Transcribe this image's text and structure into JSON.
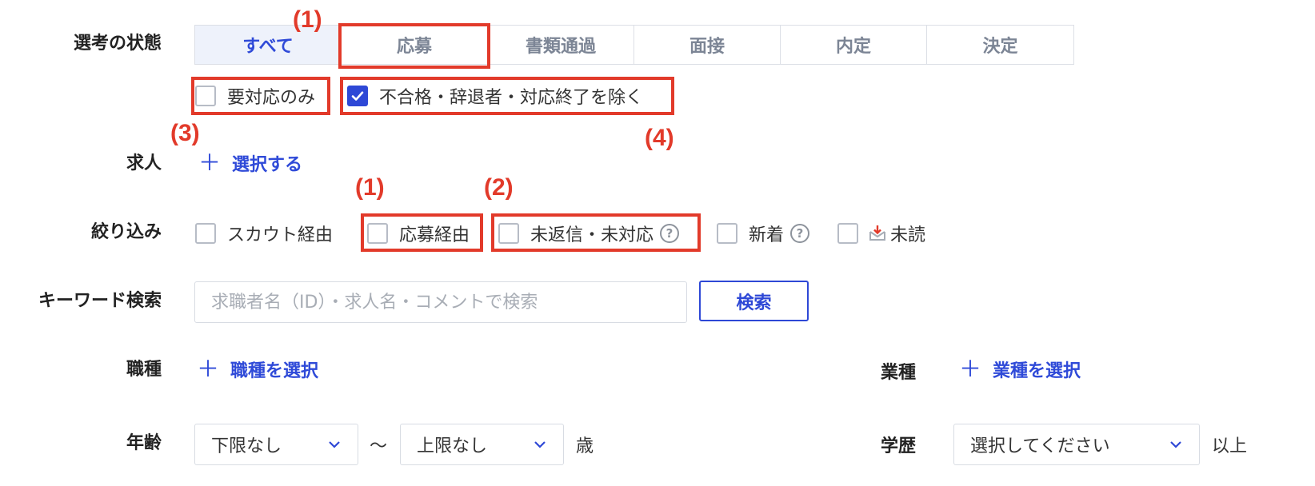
{
  "status_filter": {
    "label": "選考の状態",
    "tabs": [
      {
        "label": "すべて",
        "active": true
      },
      {
        "label": "応募",
        "active": false
      },
      {
        "label": "書類通過",
        "active": false
      },
      {
        "label": "面接",
        "active": false
      },
      {
        "label": "内定",
        "active": false
      },
      {
        "label": "決定",
        "active": false
      }
    ],
    "checkbox_needs_action": {
      "label": "要対応のみ",
      "checked": false
    },
    "checkbox_exclude": {
      "label": "不合格・辞退者・対応終了を除く",
      "checked": true
    }
  },
  "jobs": {
    "label": "求人",
    "add_label": "選択する"
  },
  "narrow": {
    "label": "絞り込み",
    "options": [
      {
        "label": "スカウト経由",
        "checked": false
      },
      {
        "label": "応募経由",
        "checked": false
      },
      {
        "label": "未返信・未対応",
        "checked": false,
        "help": "?"
      },
      {
        "label": "新着",
        "checked": false,
        "help": "?"
      },
      {
        "label": "未読",
        "checked": false
      }
    ]
  },
  "keyword": {
    "label": "キーワード検索",
    "placeholder": "求職者名（ID）・求人名・コメントで検索",
    "value": "",
    "button": "検索"
  },
  "occupation": {
    "label": "職種",
    "add_label": "職種を選択"
  },
  "industry": {
    "label": "業種",
    "add_label": "業種を選択"
  },
  "age": {
    "label": "年齢",
    "min_value": "下限なし",
    "separator": "〜",
    "max_value": "上限なし",
    "unit": "歳"
  },
  "education": {
    "label": "学歴",
    "value": "選択してください",
    "suffix": "以上"
  },
  "annotations": {
    "marker_1": "(1)",
    "marker_2": "(2)",
    "marker_3": "(3)",
    "marker_4": "(4)",
    "color": "#e23a2a"
  },
  "colors": {
    "accent": "#2e48d6",
    "active_tab_bg": "#eef2fb"
  },
  "icons": {
    "plus": "plus-icon",
    "chevron": "chevron-down-icon",
    "check": "check-icon",
    "unread": "mail-download-icon",
    "help": "help-circle-icon"
  }
}
